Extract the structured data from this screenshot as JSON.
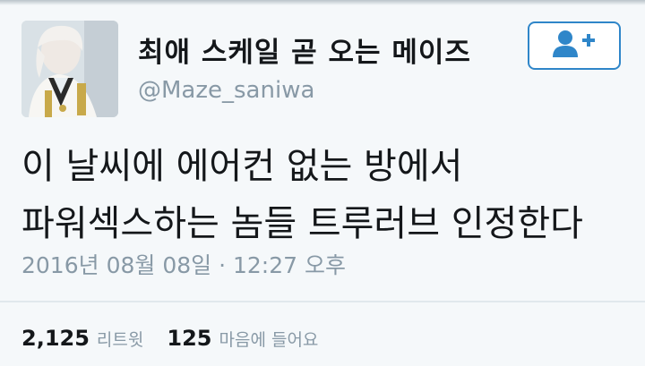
{
  "tweet": {
    "author": {
      "display_name": "최애 스케일 곧 오는 메이즈",
      "handle": "@Maze_saniwa",
      "avatar_icon": "profile-avatar-icon"
    },
    "follow_button": {
      "icon": "add-user-icon",
      "color": "#2f86c9"
    },
    "text_lines": [
      "이 날씨에 에어컨 없는 방에서",
      "파워섹스하는 놈들 트루러브 인정한다"
    ],
    "timestamp": "2016년 08월 08일 · 12:27 오후",
    "stats": {
      "retweets": {
        "count": "2,125",
        "label": "리트윗"
      },
      "likes": {
        "count": "125",
        "label": "마음에 들어요"
      }
    }
  }
}
